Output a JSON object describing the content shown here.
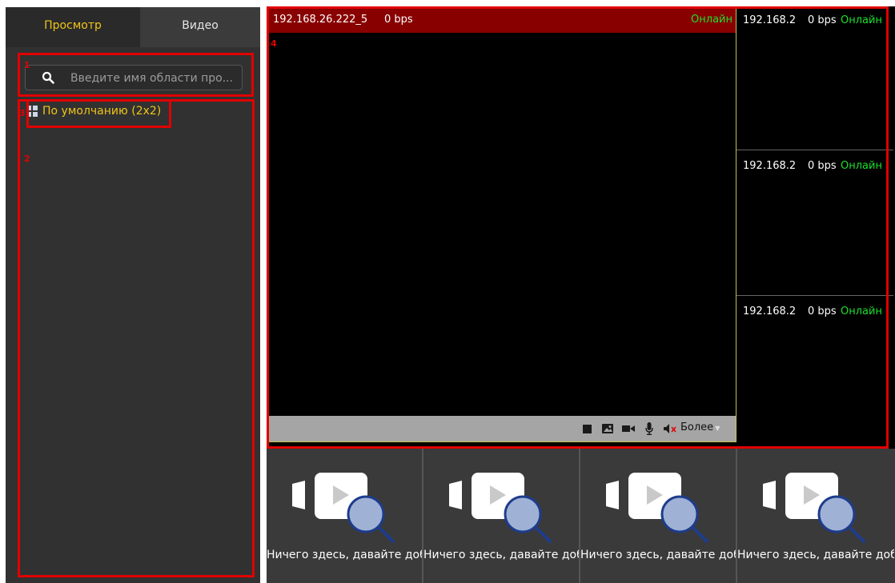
{
  "left_panel": {
    "tabs": [
      {
        "label": "Просмотр",
        "active": true
      },
      {
        "label": "Видео",
        "active": false
      }
    ],
    "search": {
      "placeholder": "Введите имя области про..."
    },
    "layouts": [
      {
        "label": "По умолчанию (2x2)",
        "icon": "grid-icon"
      }
    ]
  },
  "markers": [
    "1",
    "2",
    "3",
    "4"
  ],
  "main_view": {
    "ip": "192.168.26.222_5",
    "bitrate": "0 bps",
    "status": "Онлайн",
    "toolbar": {
      "icons": [
        "stop-icon",
        "snapshot-icon",
        "record-icon",
        "microphone-icon",
        "mute-icon"
      ],
      "more_label": "Более"
    }
  },
  "side_views": [
    {
      "ip": "192.168.2",
      "bitrate": "0 bps",
      "status": "Онлайн"
    },
    {
      "ip": "192.168.2",
      "bitrate": "0 bps",
      "status": "Онлайн"
    },
    {
      "ip": "192.168.2",
      "bitrate": "0 bps",
      "status": "Онлайн"
    }
  ],
  "empty_cells": [
    {
      "text": "Ничего здесь, давайте доб"
    },
    {
      "text": "Ничего здесь, давайте доб"
    },
    {
      "text": "Ничего здесь, давайте доб"
    },
    {
      "text": "Ничего здесь, давайте доб"
    }
  ],
  "colors": {
    "accent": "#f0c419",
    "online": "#1be12d",
    "header_bg": "#880000",
    "highlight": "#e10000"
  }
}
